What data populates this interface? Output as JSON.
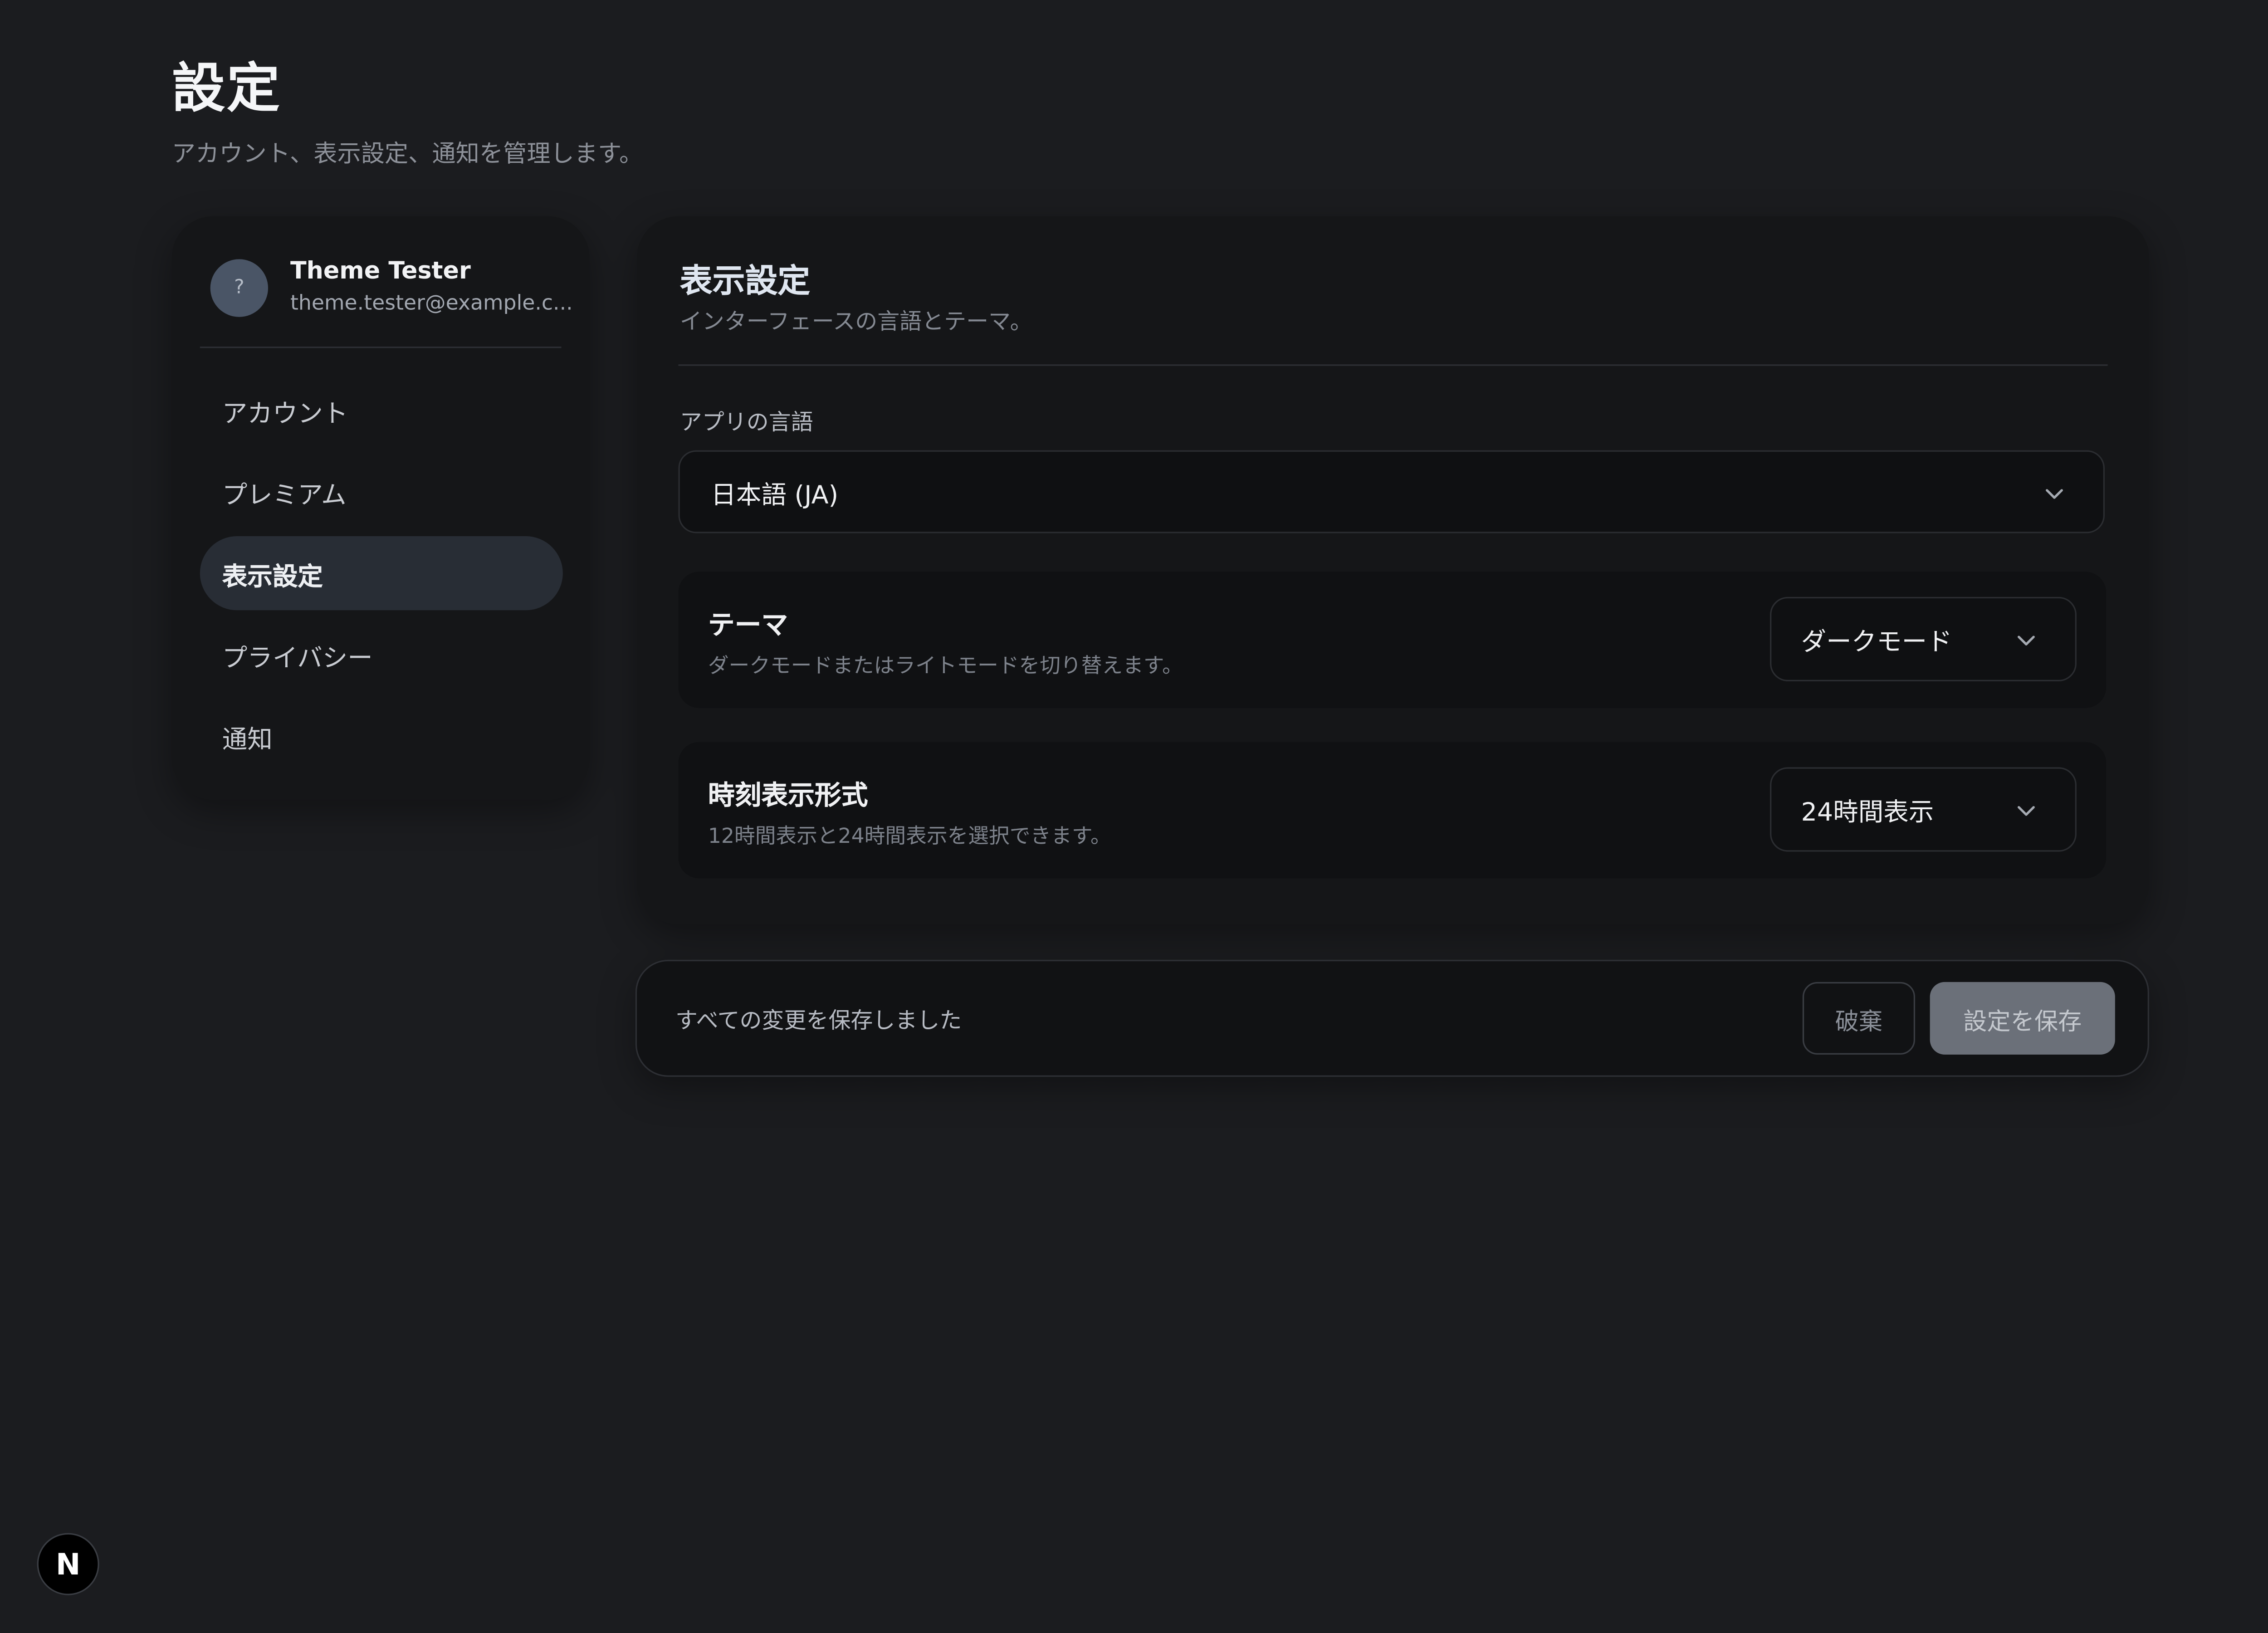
{
  "page": {
    "title": "設定",
    "subtitle": "アカウント、表示設定、通知を管理します。"
  },
  "profile": {
    "avatar_text": "?",
    "name": "Theme Tester",
    "email": "theme.tester@example.c..."
  },
  "sidebar": {
    "items": [
      {
        "label": "アカウント",
        "active": false
      },
      {
        "label": "プレミアム",
        "active": false
      },
      {
        "label": "表示設定",
        "active": true
      },
      {
        "label": "プライバシー",
        "active": false
      },
      {
        "label": "通知",
        "active": false
      }
    ]
  },
  "panel": {
    "title": "表示設定",
    "subtitle": "インターフェースの言語とテーマ。",
    "language": {
      "label": "アプリの言語",
      "value": "日本語 (JA)"
    },
    "theme": {
      "title": "テーマ",
      "description": "ダークモードまたはライトモードを切り替えます。",
      "value": "ダークモード"
    },
    "time_format": {
      "title": "時刻表示形式",
      "description": "12時間表示と24時間表示を選択できます。",
      "value": "24時間表示"
    }
  },
  "save_bar": {
    "status": "すべての変更を保存しました",
    "discard_label": "破棄",
    "save_label": "設定を保存"
  },
  "badge": {
    "label": "N"
  },
  "colors": {
    "background": "#1b1c1f",
    "card": "#151618",
    "active_nav": "#282d35",
    "save_button": "#6b7079"
  },
  "icons": {
    "select_chevron": "chevron-down-icon",
    "framework_badge": "next-logo-icon"
  }
}
